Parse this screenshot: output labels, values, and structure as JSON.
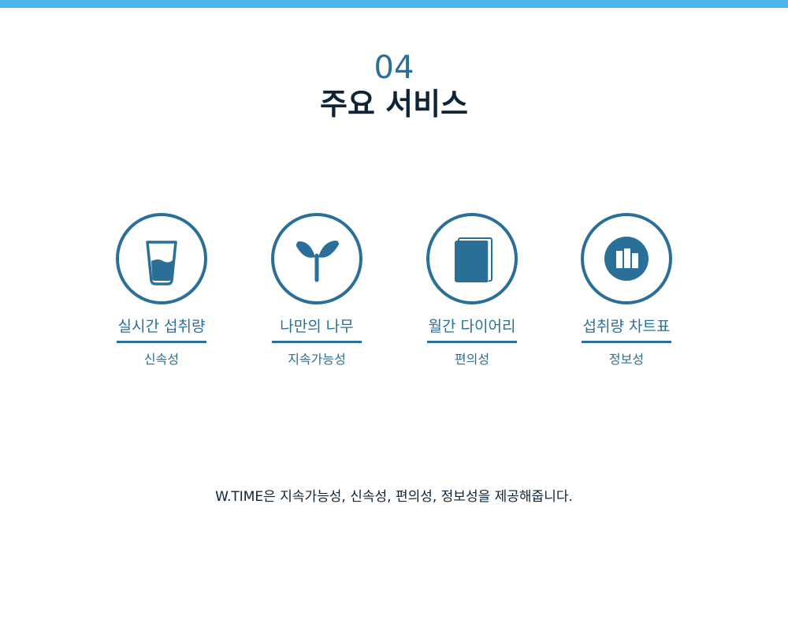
{
  "section": {
    "number": "04",
    "title": "주요 서비스"
  },
  "services": [
    {
      "name": "실시간 섭취량",
      "desc": "신속성",
      "icon": "water-glass-icon"
    },
    {
      "name": "나만의 나무",
      "desc": "지속가능성",
      "icon": "sprout-icon"
    },
    {
      "name": "월간 다이어리",
      "desc": "편의성",
      "icon": "book-icon"
    },
    {
      "name": "섭취량 차트표",
      "desc": "정보성",
      "icon": "bar-chart-icon"
    }
  ],
  "footer": {
    "text": "W.TIME은 지속가능성, 신속성, 편의성, 정보성을 제공해줍니다."
  },
  "colors": {
    "accent": "#2a6f98",
    "top_bar": "#4bb4f0",
    "title": "#0d2436"
  }
}
